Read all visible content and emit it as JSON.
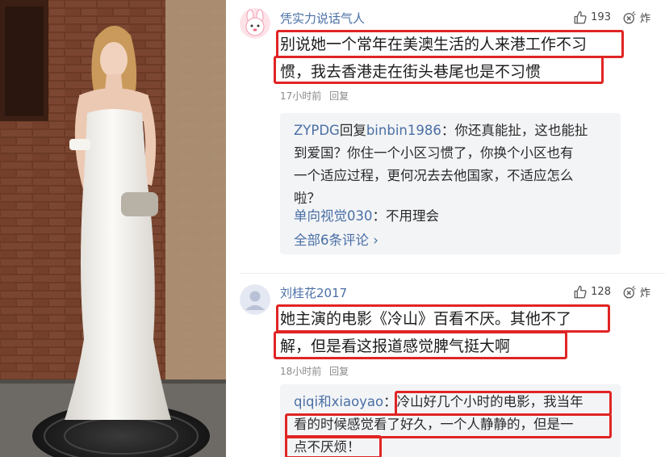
{
  "comments": [
    {
      "username": "凭实力说话气人",
      "likes": "193",
      "reaction_label": "炸",
      "body_lines": [
        "别说她一个常年在美澳生活的人来港工作不习",
        "惯，我去香港走在街头巷尾也是不习惯"
      ],
      "time": "17小时前",
      "reply_label": "回复",
      "replies": {
        "author": "ZYPDG",
        "reply_word": "回复",
        "target": "binbin1986",
        "lines": [
          "：你还真能扯，这也能扯",
          "到爱国？你住一个小区习惯了，你换个小区也有",
          "一个适应过程，更何况去去他国家，不适应怎么",
          "啦？"
        ],
        "second_author": "单向视觉030",
        "second_text": "：不用理会",
        "more": "全部6条评论 ›"
      }
    },
    {
      "username": "刘桂花2017",
      "likes": "128",
      "reaction_label": "炸",
      "body_lines": [
        "她主演的电影《冷山》百看不厌。其他不了",
        "解，但是看这报道感觉脾气挺大啊"
      ],
      "time": "18小时前",
      "reply_label": "回复",
      "replies": {
        "author": "qiqi和xiaoyao",
        "lines": [
          "：冷山好几个小时的电影，我当年",
          "看的时候感觉看了好久，一个人静静的，但是一",
          "点不厌烦！"
        ]
      }
    }
  ],
  "colors": {
    "link": "#4a6fa5",
    "highlight": "#e12424",
    "reply_bg": "#f3f4f6"
  },
  "icons": [
    "thumb-up-icon",
    "explode-icon",
    "rabbit-avatar-icon",
    "default-avatar-icon"
  ]
}
